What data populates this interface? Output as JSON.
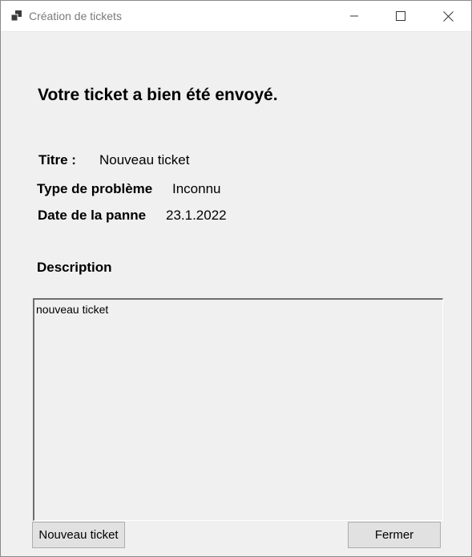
{
  "window": {
    "title": "Création de tickets",
    "controls": {
      "minimize": "minimize-icon",
      "maximize": "maximize-icon",
      "close": "close-icon"
    }
  },
  "main": {
    "heading": "Votre ticket a bien été envoyé.",
    "fields": {
      "title_label": "Titre :",
      "title_value": "Nouveau ticket",
      "type_label": "Type de problème",
      "type_value": "Inconnu",
      "date_label": "Date de la panne",
      "date_value": "23.1.2022"
    },
    "description_label": "Description",
    "description_value": "nouveau ticket"
  },
  "buttons": {
    "new_ticket": "Nouveau ticket",
    "close": "Fermer"
  },
  "colors": {
    "window_bg": "#f0f0f0",
    "titlebar_bg": "#ffffff",
    "button_bg": "#e1e1e1"
  }
}
